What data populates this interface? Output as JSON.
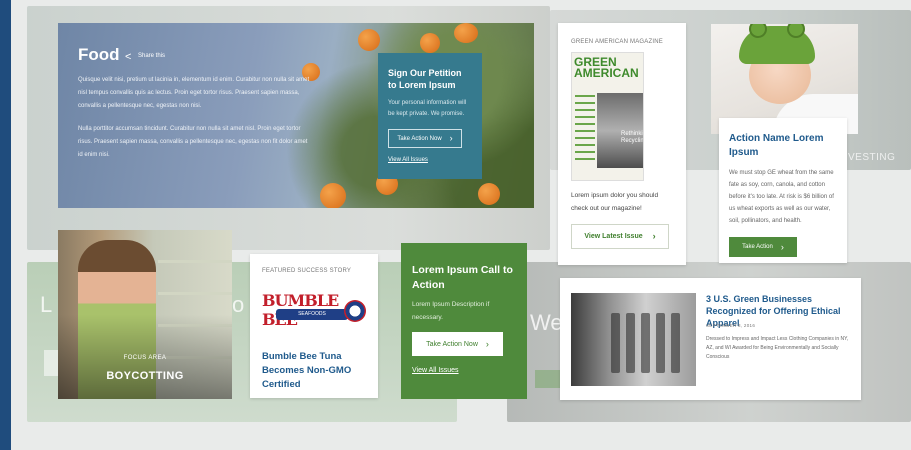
{
  "hero": {
    "title": "Food",
    "share_label": "Share this",
    "body_p1": "Quisque velit nisi, pretium ut lacinia in, elementum id enim. Curabitur non nulla sit amet nisl tempus convallis quis ac lectus. Proin eget tortor risus. Praesent sapien massa, convallis a pellentesque nec, egestas non nisi.",
    "body_p2": "Nulla porttitor accumsan tincidunt. Curabitur non nulla sit amet nisl. Proin eget tortor risus. Praesent sapien massa, convallis a pellentesque nec, egestas non fit dolor amet id enim nisi."
  },
  "petition": {
    "title": "Sign Our Petition to Lorem Ipsum",
    "description": "Your personal information will be kept private. We promise.",
    "button_label": "Take Action Now",
    "link_label": "View All Issues"
  },
  "magazine": {
    "label": "GREEN AMERICAN MAGAZINE",
    "cover_logo_line1": "GREEN",
    "cover_logo_line2": "AMERICAN",
    "cover_inset": "Rethinking Recycling",
    "description": "Lorem ipsum dolor you should check out our magazine!",
    "button_label": "View Latest Issue"
  },
  "background": {
    "right_text": "VESTING",
    "left_text": "L",
    "left_text2": "o",
    "right_panel_text": "We"
  },
  "action_card": {
    "title": "Action Name Lorem Ipsum",
    "description": "We must stop GE wheat from the same fate as soy, corn, canola, and cotton before it's too late. At risk is $6 billion of us wheat exports as well as our water, soil, pollinators, and health.",
    "button_label": "Take Action"
  },
  "focus": {
    "label": "FOCUS AREA",
    "title": "BOYCOTTING"
  },
  "success": {
    "label": "FEATURED SUCCESS STORY",
    "logo_word": "BUMBLE BEE",
    "logo_ribbon": "SEAFOODS",
    "title": "Bumble Bee Tuna Becomes Non-GMO Certified"
  },
  "cta": {
    "title": "Lorem Ipsum Call to Action",
    "description": "Lorem Ipsum Description if necessary.",
    "button_label": "Take Action Now",
    "link_label": "View All Issues"
  },
  "article": {
    "title": "3 U.S. Green Businesses Recognized for Offering Ethical Apparel",
    "date": "SEPTEMBER 8, 2016",
    "description": "Dressed to Impress and Impact Less Clothing Companies in NY, AZ, and WI Awarded for Being Environmentally and Socially Conscious"
  },
  "icons": {
    "chevron": "›",
    "share": "<"
  },
  "colors": {
    "brand_blue": "#1f5a8c",
    "brand_green": "#4f8a3c",
    "petition_teal": "#367a8e",
    "side_strip": "#1f4c7d"
  }
}
